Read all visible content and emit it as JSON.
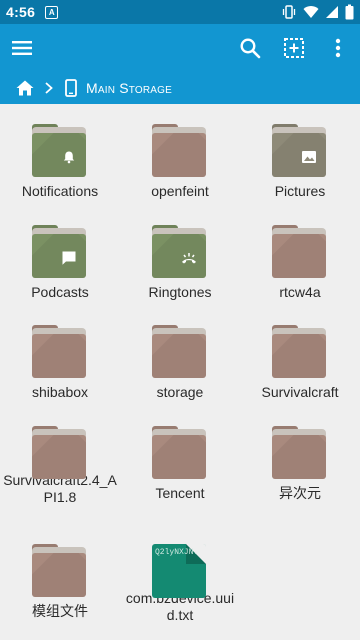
{
  "status_bar": {
    "time": "4:56",
    "notification_letter": "A",
    "icons": [
      "vibrate-icon",
      "wifi-icon",
      "signal-icon",
      "battery-icon"
    ]
  },
  "app_bar": {
    "icons": [
      "menu-icon",
      "search-icon",
      "select-all-icon",
      "overflow-menu-icon"
    ]
  },
  "breadcrumb": {
    "home_icon": "home-icon",
    "separator_icon": "chevron-right-icon",
    "device_icon": "phone-icon",
    "location": "Main Storage"
  },
  "colors": {
    "appbar": "#1296d1",
    "statusbar": "#0a77a8",
    "folder_default": "#a98a7e",
    "folder_special": "#7b9163",
    "folder_pictures": "#8e8a78",
    "file_thumb": "#148a72"
  },
  "items": [
    {
      "label": "Notifications",
      "type": "folder",
      "variant": "special",
      "badge": "bell-icon"
    },
    {
      "label": "openfeint",
      "type": "folder",
      "variant": "default"
    },
    {
      "label": "Pictures",
      "type": "folder",
      "variant": "pictures",
      "badge": "image-icon"
    },
    {
      "label": "Podcasts",
      "type": "folder",
      "variant": "special",
      "badge": "chat-icon"
    },
    {
      "label": "Ringtones",
      "type": "folder",
      "variant": "special",
      "badge": "ringtone-icon"
    },
    {
      "label": "rtcw4a",
      "type": "folder",
      "variant": "default"
    },
    {
      "label": "shibabox",
      "type": "folder",
      "variant": "default"
    },
    {
      "label": "storage",
      "type": "folder",
      "variant": "default"
    },
    {
      "label": "Survivalcraft",
      "type": "folder",
      "variant": "default"
    },
    {
      "label": "Survivalcraft2.4_API1.8",
      "type": "folder",
      "variant": "default"
    },
    {
      "label": "Tencent",
      "type": "folder",
      "variant": "default"
    },
    {
      "label": "异次元",
      "type": "folder",
      "variant": "default"
    },
    {
      "label": "模组文件",
      "type": "folder",
      "variant": "default"
    },
    {
      "label": "com.bzdevice.uuid.txt",
      "type": "file",
      "preview": "Q2lyNXJN."
    }
  ]
}
